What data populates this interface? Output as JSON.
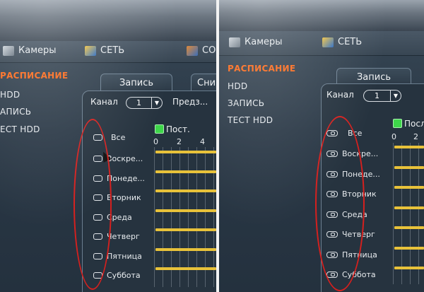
{
  "menu": {
    "cameras": "Камеры",
    "network": "СЕТЬ",
    "cut_item": "СО"
  },
  "sidebar": {
    "schedule": "РАСПИСАНИЕ",
    "hdd": "HDD",
    "record": "ЗАПИСЬ",
    "hdd_test": "ТЕСТ HDD",
    "hdd_cut": "HDD",
    "record_cut": "АПИСЬ",
    "hdd_test_cut": "ЕСТ HDD"
  },
  "tabs": {
    "record": "Запись",
    "snapshot_cut": "Сни"
  },
  "channel": {
    "label": "Канал",
    "value": "1",
    "preset_label": "Предз..."
  },
  "legend": {
    "constant": "Пост.",
    "constant_cut": "Посл"
  },
  "ticks": [
    "0",
    "2",
    "4"
  ],
  "days": {
    "all": "Все",
    "left": [
      "Воскре...",
      "Понеде...",
      "Вторник",
      "Среда",
      "Четверг",
      "Пятница",
      "Суббота"
    ],
    "right": [
      "Воскре...",
      "Понеде...",
      "Вторник",
      "Среда",
      "Четверг",
      "Пятница",
      "Суббота"
    ]
  },
  "colors": {
    "active_menu": "#ff6a1a",
    "schedule_bar": "#e8c23a",
    "legend_green": "#3ed64a",
    "annotation_red": "#d6201e"
  }
}
